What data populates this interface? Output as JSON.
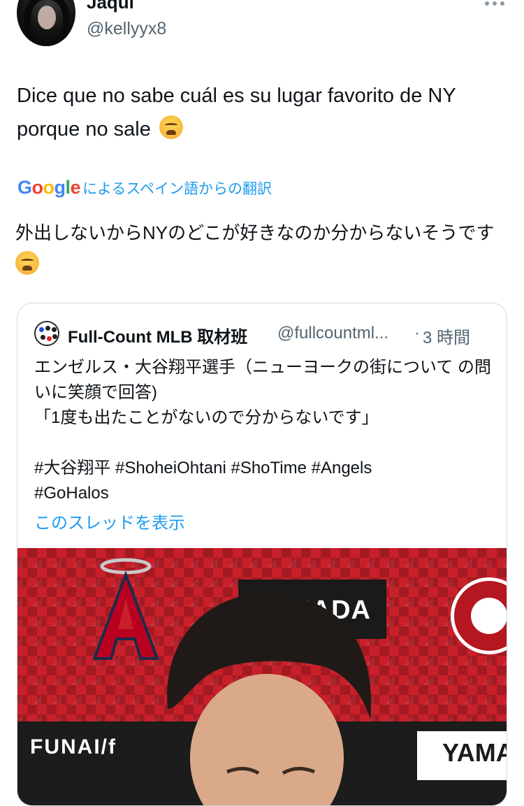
{
  "author": {
    "display_name": "Jaqui",
    "handle": "@kellyyx8"
  },
  "tweet": {
    "text": "Dice que no sabe cuál es su lugar favorito de NY porque no sale",
    "emoji": "weary-face"
  },
  "translation": {
    "provider": "Google",
    "label": "によるスペイン語からの翻訳",
    "text": "外出しないからNYのどこが好きなのか分からないそうです"
  },
  "quote": {
    "name": "Full-Count MLB 取材班",
    "handle": "@fullcountml...",
    "separator": "·",
    "time": "3 時間",
    "text": "エンゼルス・大谷翔平選手（ニューヨークの街について の問いに笑顔で回答)\n「1度も出たことがないので分からないです」\n\n#大谷翔平 #ShoheiOhtani #ShoTime #Angels\n#GoHalos",
    "thread_link": "このスレッドを表示"
  },
  "media": {
    "sponsor_top": "MADA",
    "sponsor_left": "FUNAI/f",
    "sponsor_right": "YAMA",
    "logo_a": "A"
  },
  "colors": {
    "link": "#1d9bf0",
    "muted": "#536471",
    "text": "#0f1419",
    "angels_red": "#c8202a"
  }
}
